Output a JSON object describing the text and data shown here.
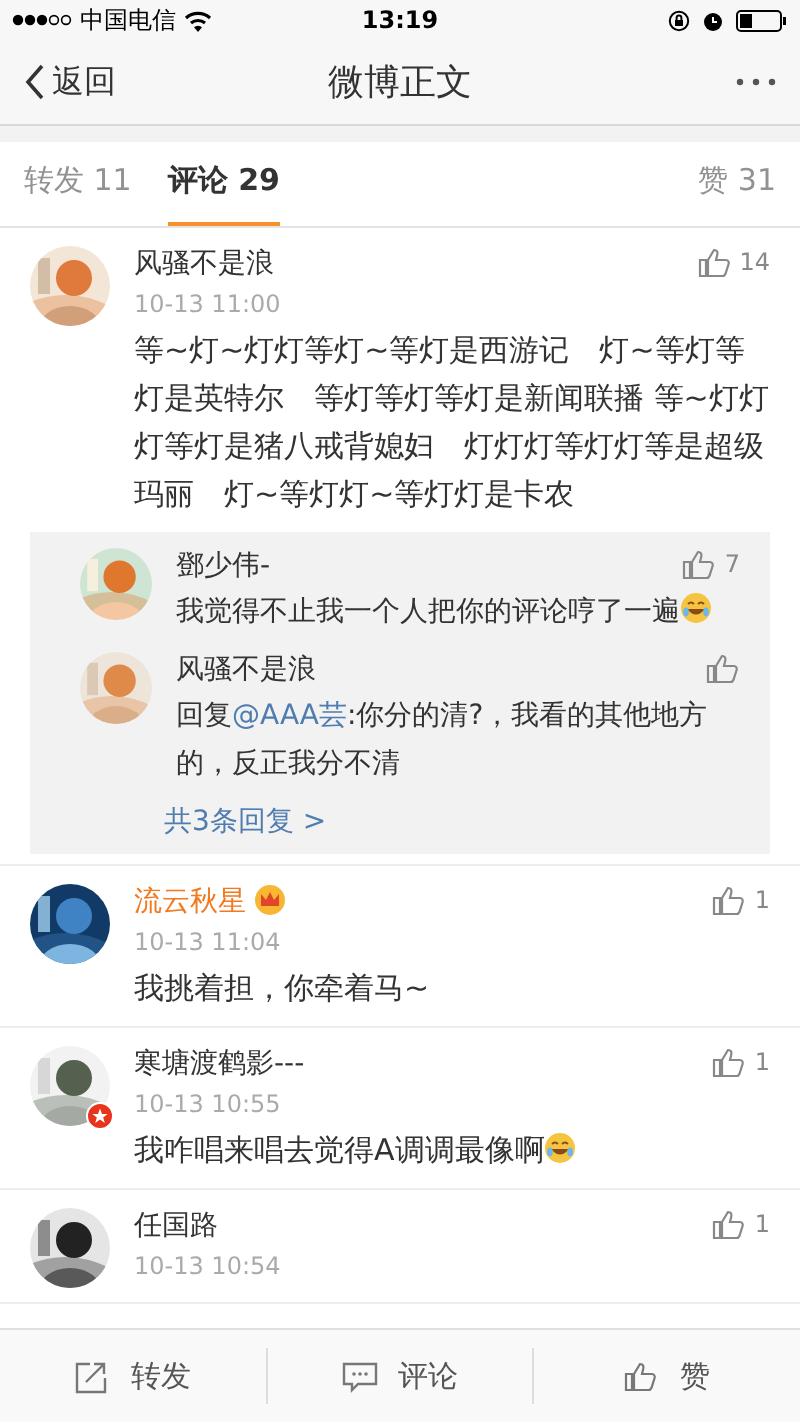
{
  "status_bar": {
    "carrier": "中国电信",
    "time": "13:19"
  },
  "nav": {
    "back": "返回",
    "title": "微博正文"
  },
  "tabs": [
    {
      "label": "转发 11",
      "selected": false
    },
    {
      "label": "评论 29",
      "selected": true
    },
    {
      "label": "赞 31",
      "selected": false
    }
  ],
  "comments": [
    {
      "name": "风骚不是浪",
      "vip": false,
      "time": "10-13 11:00",
      "likes": "14",
      "parts": [
        {
          "text": "等~灯~灯灯等灯~等灯是西游记　灯~等灯等灯是英特尔　等灯等灯等灯是新闻联播 等~灯灯灯等灯是猪八戒背媳妇　灯灯灯等灯灯等是超级玛丽　灯~等灯灯~等灯灯是卡农"
        }
      ],
      "emoji": false,
      "badge": false,
      "replies": {
        "items": [
          {
            "name": "鄧少伟-",
            "likes": "7",
            "parts": [
              {
                "text": "我觉得不止我一个人把你的评论哼了一遍"
              }
            ],
            "emoji": true
          },
          {
            "name": "风骚不是浪",
            "parts": [
              {
                "text": "回复"
              },
              {
                "text": "@AAA芸",
                "kind": "mention"
              },
              {
                "text": ":你分的清?，我看的其他地方的，反正我分不清"
              }
            ],
            "emoji": false
          }
        ],
        "more": "共3条回复 >"
      }
    },
    {
      "name": "流云秋星",
      "vip": true,
      "time": "10-13 11:04",
      "likes": "1",
      "parts": [
        {
          "text": "我挑着担，你牵着马~"
        }
      ],
      "emoji": false,
      "badge": false
    },
    {
      "name": "寒塘渡鹤影---",
      "vip": false,
      "time": "10-13 10:55",
      "likes": "1",
      "parts": [
        {
          "text": "我咋唱来唱去觉得A调调最像啊"
        }
      ],
      "emoji": true,
      "badge": true
    },
    {
      "name": "任国路",
      "vip": false,
      "time": "10-13 10:54",
      "likes": "1",
      "badge": false
    }
  ],
  "toolbar": [
    {
      "label": "转发",
      "kind": "repost"
    },
    {
      "label": "评论",
      "kind": "comment"
    },
    {
      "label": "赞",
      "kind": "like"
    }
  ]
}
